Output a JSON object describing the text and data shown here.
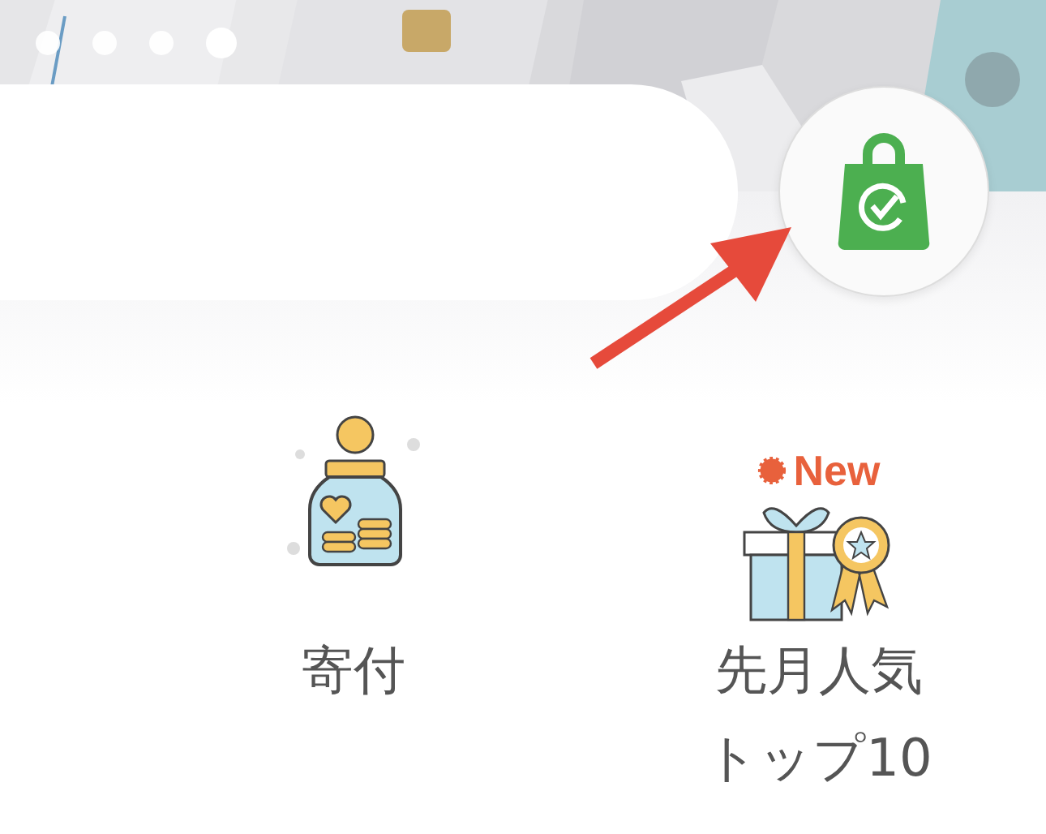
{
  "carousel": {
    "dots": [
      {
        "selected": false
      },
      {
        "selected": false
      },
      {
        "selected": false
      },
      {
        "selected": true
      }
    ]
  },
  "menu_items": [
    {
      "kind": "donation",
      "label": "寄付"
    },
    {
      "kind": "ranking",
      "label": "先月人気トップ10",
      "badge": "New"
    }
  ]
}
